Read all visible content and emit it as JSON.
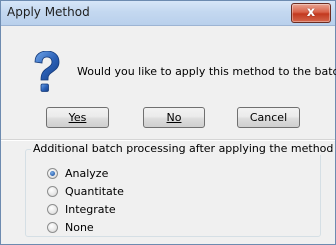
{
  "dialog": {
    "title": "Apply Method",
    "close_glyph": "x",
    "icon": "question-icon",
    "message": "Would you like to apply this method to the batch?"
  },
  "buttons": {
    "yes_label": "Yes",
    "no_label": "No",
    "cancel_label": "Cancel"
  },
  "options": {
    "group_label": "Additional batch processing after applying the method",
    "items": [
      {
        "label": "Analyze",
        "checked": true
      },
      {
        "label": "Quantitate",
        "checked": false
      },
      {
        "label": "Integrate",
        "checked": false
      },
      {
        "label": "None",
        "checked": false
      }
    ]
  },
  "colors": {
    "titlebar": "#c4d8f0",
    "close_button": "#c3391f",
    "question_icon": "#2a5fb5",
    "window_bg": "#f0f0f0"
  }
}
